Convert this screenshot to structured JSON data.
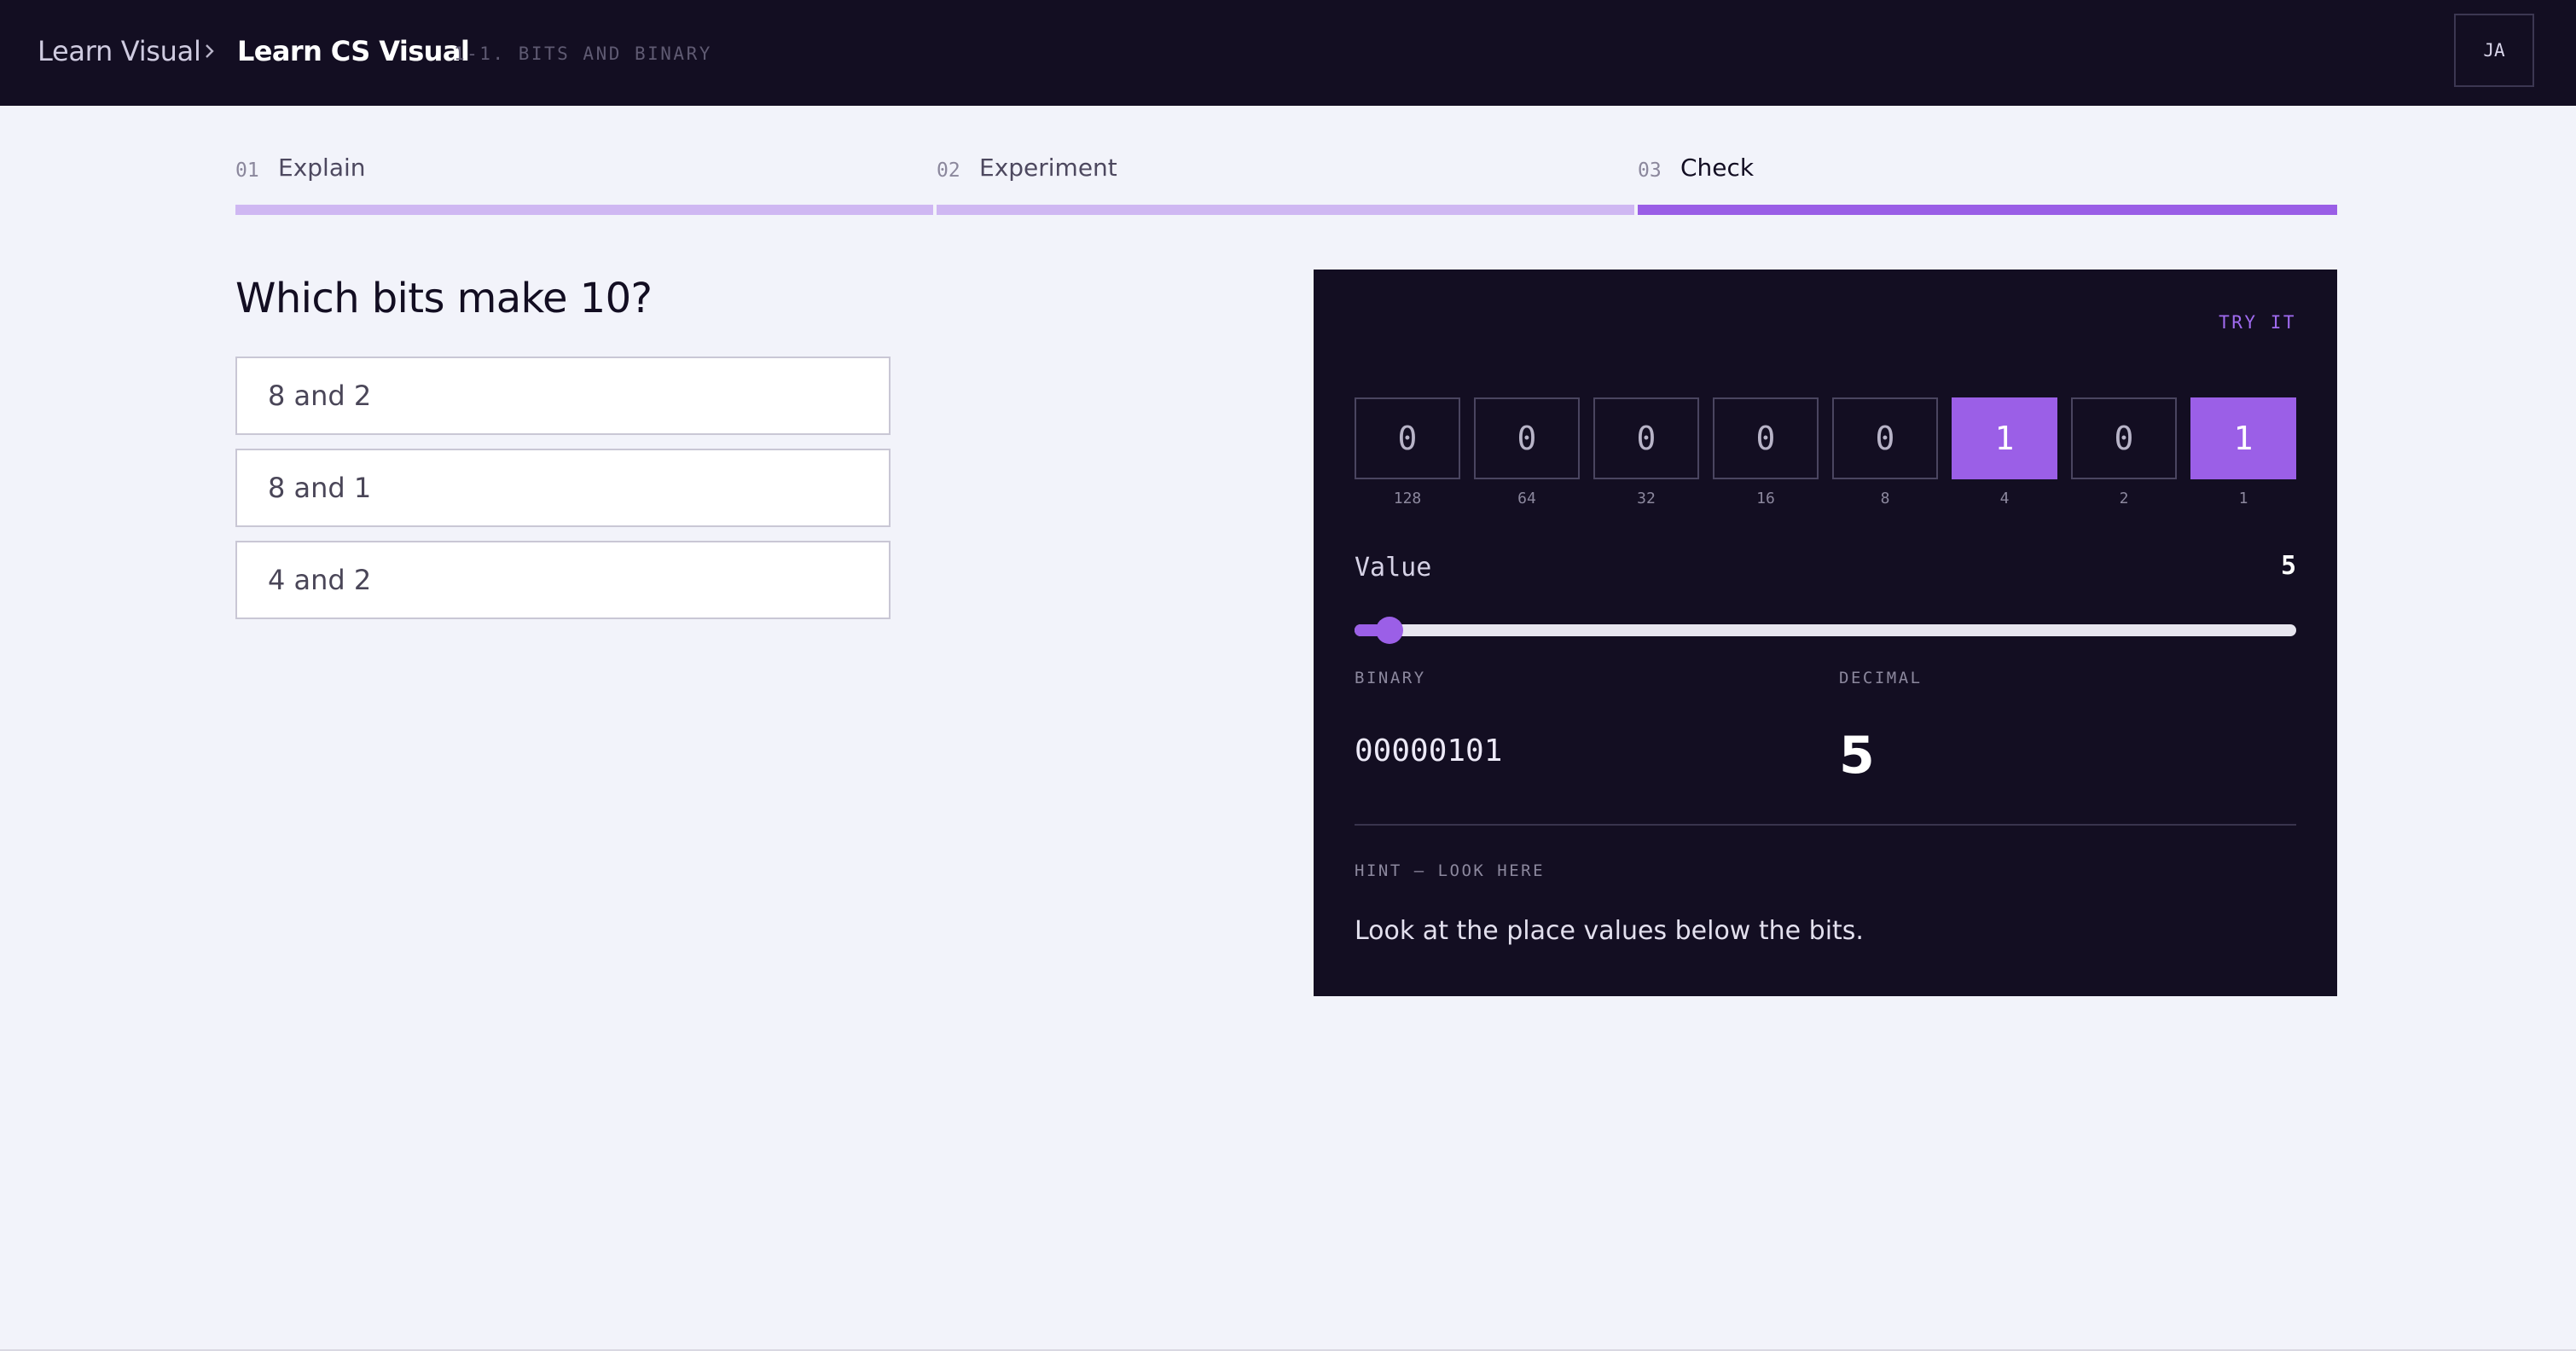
{
  "header": {
    "root_link": "Learn Visual",
    "course_title": "Learn CS Visual",
    "lesson": "1-1. BITS AND BINARY",
    "avatar_initials": "JA"
  },
  "steps": [
    {
      "num": "01",
      "label": "Explain",
      "active": false
    },
    {
      "num": "02",
      "label": "Experiment",
      "active": false
    },
    {
      "num": "03",
      "label": "Check",
      "active": true
    }
  ],
  "quiz": {
    "question": "Which bits make 10?",
    "options": [
      "8 and 2",
      "8 and 1",
      "4 and 2"
    ]
  },
  "panel": {
    "try_it_label": "TRY IT",
    "bits": [
      "0",
      "0",
      "0",
      "0",
      "0",
      "1",
      "0",
      "1"
    ],
    "place_values": [
      "128",
      "64",
      "32",
      "16",
      "8",
      "4",
      "2",
      "1"
    ],
    "value_label": "Value",
    "value": "5",
    "slider": {
      "min": 0,
      "max": 255,
      "value": 5
    },
    "binary_label": "BINARY",
    "binary_value": "00000101",
    "decimal_label": "DECIMAL",
    "decimal_value": "5",
    "hint_label": "HINT — LOOK HERE",
    "hint_text": "Look at the place values below the bits."
  },
  "colors": {
    "accent": "#9b5fe7",
    "accent_light": "#cfb7f2",
    "dark_bg": "#130e22",
    "page_bg": "#f2f3fa"
  },
  "icons": {
    "breadcrumb_separator": "chevron-right-icon"
  }
}
